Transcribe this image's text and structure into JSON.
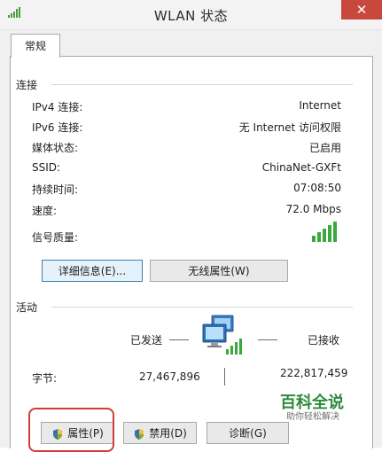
{
  "window": {
    "title": "WLAN 状态",
    "close_glyph": "✕"
  },
  "tab": {
    "label": "常规"
  },
  "connection": {
    "heading": "连接",
    "rows": [
      {
        "label": "IPv4 连接:",
        "value": "Internet"
      },
      {
        "label": "IPv6 连接:",
        "value": "无 Internet 访问权限"
      },
      {
        "label": "媒体状态:",
        "value": "已启用"
      },
      {
        "label": "SSID:",
        "value": "ChinaNet-GXFt"
      },
      {
        "label": "持续时间:",
        "value": "07:08:50"
      },
      {
        "label": "速度:",
        "value": "72.0 Mbps"
      },
      {
        "label": "信号质量:",
        "value": ""
      }
    ],
    "signal_bars": 5,
    "signal_level": 5,
    "details_button": "详细信息(E)...",
    "wireless_props_button": "无线属性(W)"
  },
  "activity": {
    "heading": "活动",
    "sent_label": "已发送",
    "received_label": "已接收",
    "bytes_label": "字节:",
    "bytes_sent": "27,467,896",
    "bytes_received": "222,817,459"
  },
  "buttons": {
    "properties": "属性(P)",
    "disable": "禁用(D)",
    "diagnose": "诊断(G)"
  },
  "watermark": {
    "title": "百科全说",
    "subtitle": "助你轻松解决"
  },
  "colors": {
    "signal": "#3aa83a",
    "highlight": "#d13c3c",
    "close": "#c9483e"
  }
}
